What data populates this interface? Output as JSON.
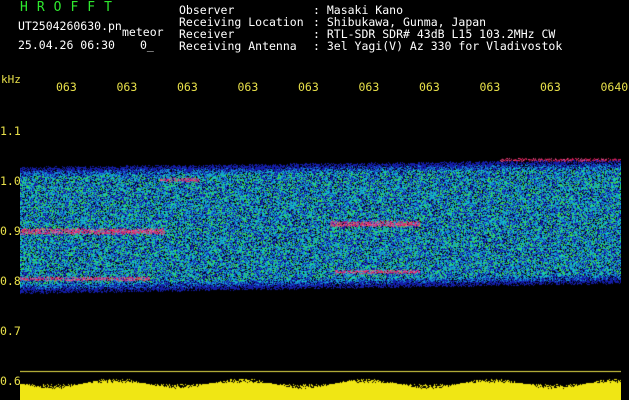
{
  "header": {
    "app_title": "HROFFT",
    "file_name": "UT2504260630.pn",
    "file_kind": "meteor",
    "date_time": "25.04.26 06:30",
    "fixed_tag": "0_",
    "info": [
      {
        "label": "Observer",
        "value": ": Masaki Kano"
      },
      {
        "label": "Receiving Location",
        "value": ": Shibukawa, Gunma, Japan"
      },
      {
        "label": "Receiver",
        "value": ": RTL-SDR SDR# 43dB L15 103.2MHz CW"
      },
      {
        "label": "Receiving Antenna",
        "value": ": 3el Yagi(V) Az 330 for Vladivostok"
      }
    ]
  },
  "chart_data": {
    "type": "heatmap",
    "ylabel": "kHz",
    "x_ticks": [
      "063",
      "063",
      "063",
      "063",
      "063",
      "063",
      "063",
      "063",
      "063",
      "0640"
    ],
    "y_ticks": [
      "1.1",
      "1.0",
      "0.9",
      "0.8",
      "0.7",
      "0.6"
    ],
    "ylim": [
      0.6,
      1.1
    ],
    "signal_band": [
      0.78,
      1.03
    ],
    "grid": false,
    "colors": {
      "background": "#000000",
      "low": "#1020b0",
      "mid": "#10c0c0",
      "high": "#30e030",
      "peak": "#ff2060",
      "labels": "#e8e04a",
      "header": "#2ee82e"
    }
  }
}
